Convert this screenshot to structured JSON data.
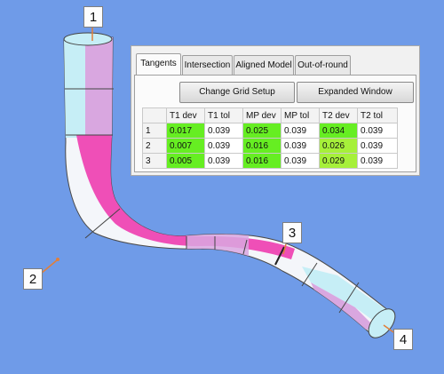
{
  "markers": [
    {
      "id": "marker-1",
      "label": "1"
    },
    {
      "id": "marker-2",
      "label": "2"
    },
    {
      "id": "marker-3",
      "label": "3"
    },
    {
      "id": "marker-4",
      "label": "4"
    }
  ],
  "colors": {
    "background": "#6f9be8",
    "tube_white": "#f4f6fa",
    "tube_cyan": "#c6eef6",
    "tube_pink": "#ef4fb7",
    "tube_lilac": "#d9a7e0",
    "cell_green": "#66ee22",
    "cell_lime": "#a6f03a"
  },
  "tabs": [
    {
      "label": "Tangents",
      "active": true
    },
    {
      "label": "Intersection",
      "active": false
    },
    {
      "label": "Aligned Model",
      "active": false
    },
    {
      "label": "Out-of-round",
      "active": false
    }
  ],
  "buttons": {
    "change_grid": "Change Grid Setup",
    "expanded": "Expanded Window"
  },
  "table": {
    "headers": [
      "",
      "T1 dev",
      "T1 tol",
      "MP dev",
      "MP tol",
      "T2 dev",
      "T2 tol"
    ],
    "rows": [
      {
        "label": "1",
        "t1_dev": "0.017",
        "t1_tol": "0.039",
        "mp_dev": "0.025",
        "mp_tol": "0.039",
        "t2_dev": "0.034",
        "t2_tol": "0.039"
      },
      {
        "label": "2",
        "t1_dev": "0.007",
        "t1_tol": "0.039",
        "mp_dev": "0.016",
        "mp_tol": "0.039",
        "t2_dev": "0.026",
        "t2_tol": "0.039"
      },
      {
        "label": "3",
        "t1_dev": "0.005",
        "t1_tol": "0.039",
        "mp_dev": "0.016",
        "mp_tol": "0.039",
        "t2_dev": "0.029",
        "t2_tol": "0.039"
      }
    ]
  }
}
